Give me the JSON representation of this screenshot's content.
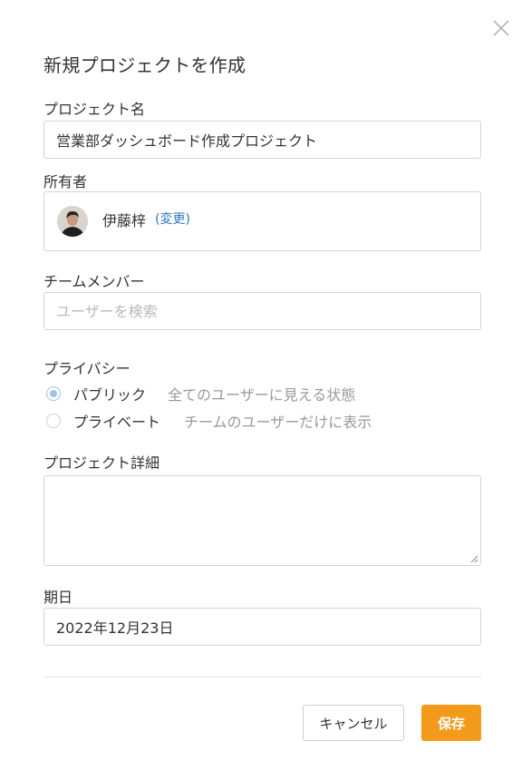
{
  "dialog": {
    "title": "新規プロジェクトを作成",
    "close_icon": "close-icon"
  },
  "project_name": {
    "label": "プロジェクト名",
    "value": "営業部ダッシュボード作成プロジェクト"
  },
  "owner": {
    "label": "所有者",
    "name": "伊藤梓",
    "change_link": "(変更)",
    "avatar_icon": "avatar"
  },
  "team_members": {
    "label": "チームメンバー",
    "placeholder": "ユーザーを検索",
    "value": ""
  },
  "privacy": {
    "label": "プライバシー",
    "options": [
      {
        "label": "パブリック",
        "description": "全てのユーザーに見える状態",
        "checked": true
      },
      {
        "label": "プライベート",
        "description": "チームのユーザーだけに表示",
        "checked": false
      }
    ]
  },
  "details": {
    "label": "プロジェクト詳細",
    "value": ""
  },
  "due_date": {
    "label": "期日",
    "value": "2022年12月23日"
  },
  "buttons": {
    "cancel_label": "キャンセル",
    "save_label": "保存"
  },
  "colors": {
    "accent": "#f39a1a",
    "link": "#2f74c0",
    "radio_checked": "#9cc3ec",
    "border": "#d4d4d4"
  }
}
